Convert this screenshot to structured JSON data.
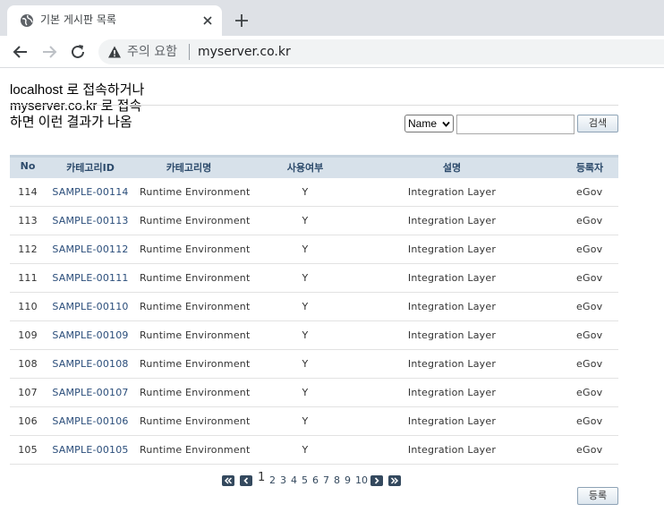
{
  "browser": {
    "tab_title": "기본 게시판 목록",
    "security_label": "주의 요함",
    "url": "myserver.co.kr"
  },
  "note": {
    "lines": [
      "localhost 로 접속하거나",
      "myserver.co.kr 로 접속",
      "하면 이런 결과가 나옴"
    ]
  },
  "search": {
    "condition_selected": "Name",
    "keyword_value": "",
    "button_label": "검색"
  },
  "table": {
    "headers": [
      "No",
      "카테고리ID",
      "카테고리명",
      "사용여부",
      "설명",
      "등록자"
    ],
    "rows": [
      {
        "no": "114",
        "id": "SAMPLE-00114",
        "name": "Runtime Environment",
        "use": "Y",
        "desc": "Integration Layer",
        "user": "eGov"
      },
      {
        "no": "113",
        "id": "SAMPLE-00113",
        "name": "Runtime Environment",
        "use": "Y",
        "desc": "Integration Layer",
        "user": "eGov"
      },
      {
        "no": "112",
        "id": "SAMPLE-00112",
        "name": "Runtime Environment",
        "use": "Y",
        "desc": "Integration Layer",
        "user": "eGov"
      },
      {
        "no": "111",
        "id": "SAMPLE-00111",
        "name": "Runtime Environment",
        "use": "Y",
        "desc": "Integration Layer",
        "user": "eGov"
      },
      {
        "no": "110",
        "id": "SAMPLE-00110",
        "name": "Runtime Environment",
        "use": "Y",
        "desc": "Integration Layer",
        "user": "eGov"
      },
      {
        "no": "109",
        "id": "SAMPLE-00109",
        "name": "Runtime Environment",
        "use": "Y",
        "desc": "Integration Layer",
        "user": "eGov"
      },
      {
        "no": "108",
        "id": "SAMPLE-00108",
        "name": "Runtime Environment",
        "use": "Y",
        "desc": "Integration Layer",
        "user": "eGov"
      },
      {
        "no": "107",
        "id": "SAMPLE-00107",
        "name": "Runtime Environment",
        "use": "Y",
        "desc": "Integration Layer",
        "user": "eGov"
      },
      {
        "no": "106",
        "id": "SAMPLE-00106",
        "name": "Runtime Environment",
        "use": "Y",
        "desc": "Integration Layer",
        "user": "eGov"
      },
      {
        "no": "105",
        "id": "SAMPLE-00105",
        "name": "Runtime Environment",
        "use": "Y",
        "desc": "Integration Layer",
        "user": "eGov"
      }
    ]
  },
  "pager": {
    "current": "1",
    "pages": [
      "2",
      "3",
      "4",
      "5",
      "6",
      "7",
      "8",
      "9",
      "10"
    ]
  },
  "actions": {
    "register_label": "등록"
  },
  "colors": {
    "header_bg": "#d7e1ea",
    "header_text": "#2c4a6b",
    "link_text": "#2a4d7a",
    "pager_button": "#34495e"
  }
}
